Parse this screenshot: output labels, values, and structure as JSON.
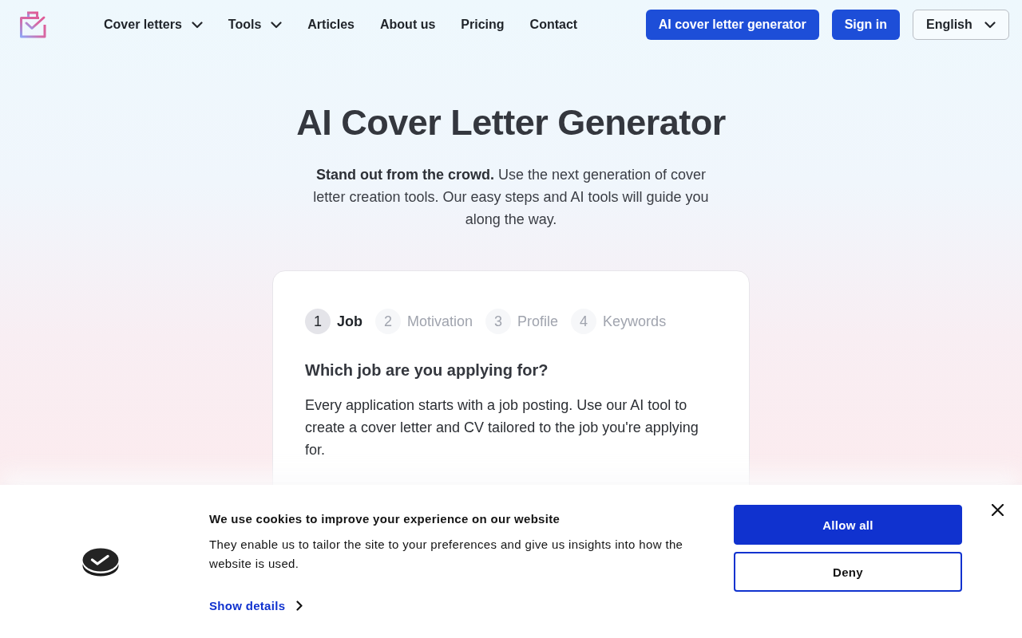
{
  "header": {
    "nav": [
      {
        "label": "Cover letters",
        "kind": "menu"
      },
      {
        "label": "Tools",
        "kind": "menu"
      },
      {
        "label": "Articles",
        "kind": "link"
      },
      {
        "label": "About us",
        "kind": "link"
      },
      {
        "label": "Pricing",
        "kind": "link"
      },
      {
        "label": "Contact",
        "kind": "link"
      }
    ],
    "actions": [
      {
        "label": "AI cover letter generator"
      },
      {
        "label": "Sign in"
      }
    ],
    "language": {
      "value": "English"
    }
  },
  "hero": {
    "title": "AI Cover Letter Generator",
    "intro": "**Stand out from the crowd.** Use the next generation of cover letter creation tools. Our easy steps and AI tools will guide you along the way."
  },
  "wizard": {
    "steps": [
      {
        "number": "1",
        "label": "Job",
        "selected": true
      },
      {
        "number": "2",
        "label": "Motivation",
        "selected": false
      },
      {
        "number": "3",
        "label": "Profile",
        "selected": false
      },
      {
        "number": "4",
        "label": "Keywords",
        "selected": false
      }
    ],
    "question": "Which job are you applying for?",
    "description": "Every application starts with a job posting. Use our AI tool to create a cover letter and CV tailored to the job you're applying for."
  },
  "cookie_banner": {
    "title": "We use cookies to improve your experience on our website",
    "text": "They enable us to tailor the site to your preferences and give us insights into how the website is used.",
    "details_link": "Show details",
    "buttons": [
      {
        "label": "Allow all",
        "kind": "primary"
      },
      {
        "label": "Deny",
        "kind": "secondary"
      }
    ]
  }
}
